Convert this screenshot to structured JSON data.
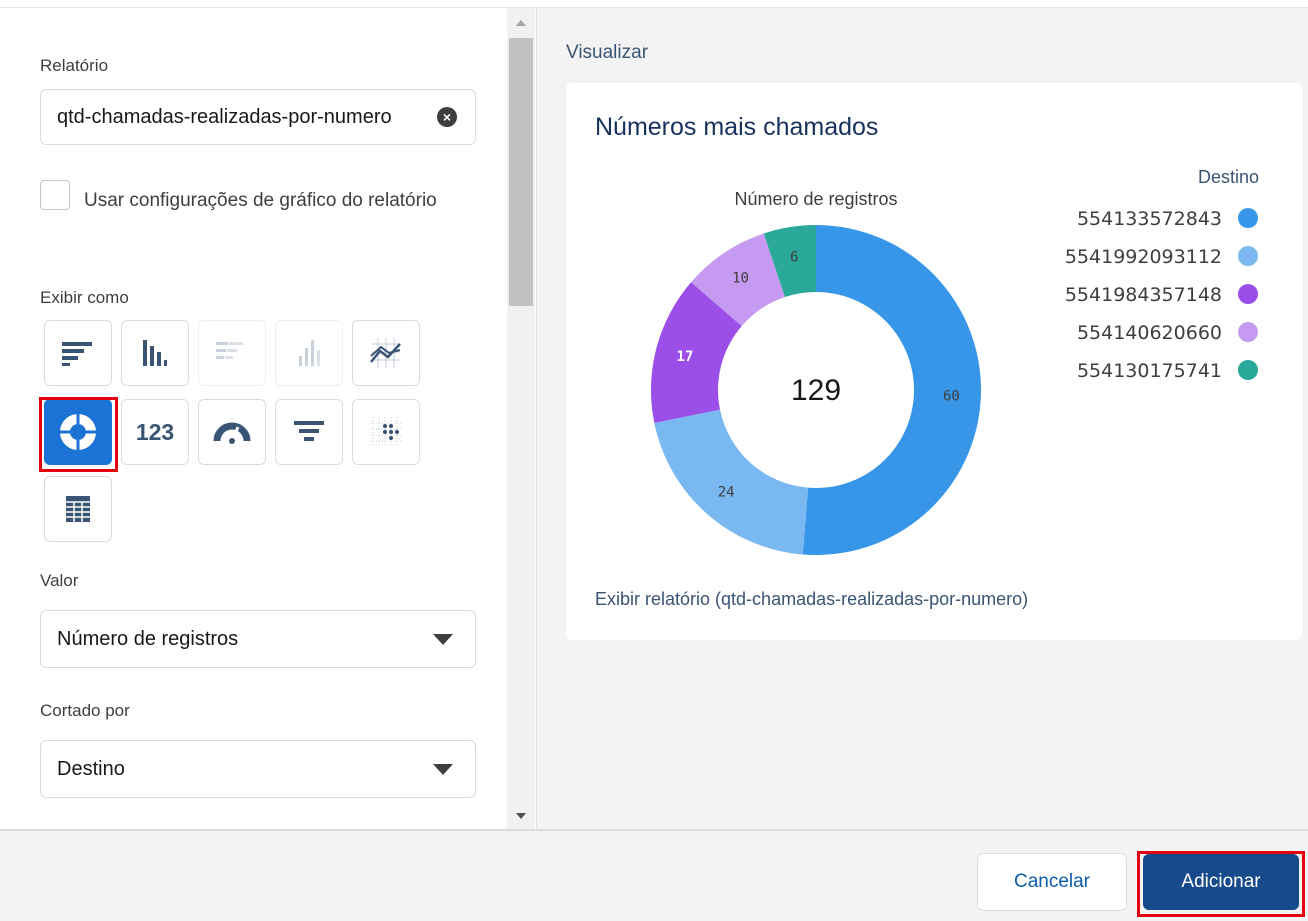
{
  "form": {
    "report_label": "Relatório",
    "report_value": "qtd-chamadas-realizadas-por-numero",
    "clear_symbol": "×",
    "use_report_settings_label": "Usar configurações de gráfico do relatório",
    "use_report_settings_checked": false,
    "display_as_label": "Exibir como",
    "chart_types": [
      {
        "icon": "horizontal-bar-chart-icon",
        "enabled": true,
        "selected": false
      },
      {
        "icon": "vertical-bar-chart-icon",
        "enabled": true,
        "selected": false
      },
      {
        "icon": "stacked-horizontal-bar-icon",
        "enabled": false,
        "selected": false
      },
      {
        "icon": "stacked-vertical-bar-icon",
        "enabled": false,
        "selected": false
      },
      {
        "icon": "line-chart-icon",
        "enabled": true,
        "selected": false
      },
      {
        "icon": "donut-chart-icon",
        "enabled": true,
        "selected": true
      },
      {
        "icon": "metric-icon",
        "enabled": true,
        "selected": false,
        "text": "123"
      },
      {
        "icon": "gauge-icon",
        "enabled": true,
        "selected": false
      },
      {
        "icon": "funnel-icon",
        "enabled": true,
        "selected": false
      },
      {
        "icon": "scatter-chart-icon",
        "enabled": true,
        "selected": false
      },
      {
        "icon": "table-icon",
        "enabled": true,
        "selected": false
      }
    ],
    "value_label": "Valor",
    "value_selected": "Número de registros",
    "sliced_by_label": "Cortado por",
    "sliced_by_selected": "Destino"
  },
  "preview": {
    "label": "Visualizar",
    "title": "Números mais chamados",
    "report_link": "Exibir relatório (qtd-chamadas-realizadas-por-numero)"
  },
  "chart_data": {
    "type": "pie",
    "subtitle": "Número de registros",
    "legend_title": "Destino",
    "legend_position": "right",
    "total": "129",
    "categories": [
      "554133572843",
      "5541992093112",
      "5541984357148",
      "554140620660",
      "554130175741"
    ],
    "values": [
      60,
      24,
      17,
      10,
      6
    ],
    "colors": [
      "#3796e8",
      "#79b8f0",
      "#9b4ee8",
      "#c59af0",
      "#2aa89a"
    ]
  },
  "footer": {
    "cancel_label": "Cancelar",
    "add_label": "Adicionar"
  }
}
